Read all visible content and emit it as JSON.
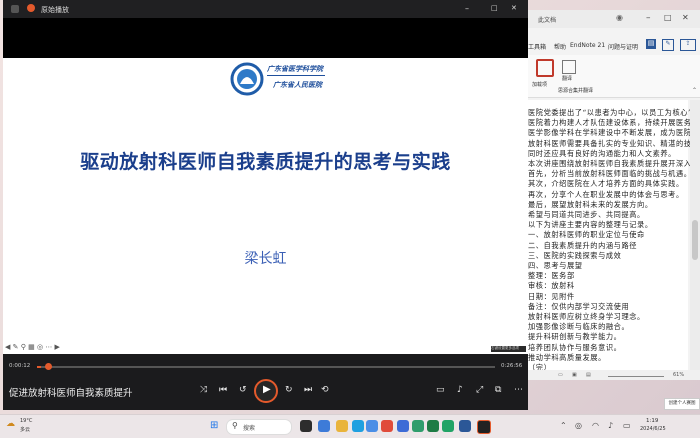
{
  "player": {
    "window_title": "原始播放",
    "slide": {
      "logo_line1": "广东省医学科学院",
      "logo_line2": "广东省人民医院",
      "title": "驱动放射科医师自我素质提升的思考与实践",
      "author": "梁长虹"
    },
    "time_current": "0:00:12",
    "time_total": "0:26:56",
    "progress_fraction": 0.008,
    "now_playing": "促进放射科医师自我素质提升",
    "tooltip": "右键设置更多选项"
  },
  "word": {
    "window_title": "此文档",
    "ribbon_tabs": [
      "工具箱",
      "帮助",
      "EndNote 21",
      "问题与证明"
    ],
    "ribbon_groups": [
      "加载项",
      "翻译",
      "思源合集并翻译"
    ],
    "zoom": "61%",
    "doc_lines": [
      "医院党委提出了“以患者为中心，以员工为核心”的理念。",
      "医院着力构建人才队伍建设体系，持续开展医务人员素质提升工程。",
      "医学影像学科在学科建设中不断发展，成为医院重点学科之一。",
      "放射科医师需要具备扎实的专业知识、精湛的技术水平。",
      "同时还应具有良好的沟通能力和人文素养。",
      "本次讲座围绕放射科医师自我素质提升展开深入探讨。",
      "首先，分析当前放射科医师面临的挑战与机遇。",
      "其次，介绍医院在人才培养方面的具体实践。",
      "再次，分享个人在职业发展中的体会与思考。",
      "最后，展望放射科未来的发展方向。",
      "希望与同道共同进步、共同提高。",
      "以下为讲座主要内容的整理与记录。",
      "一、放射科医师的职业定位与使命",
      "二、自我素质提升的内涵与路径",
      "三、医院的实践探索与成效",
      "四、思考与展望",
      "整理：医务部",
      "审核：放射科",
      "日期：见附件",
      "备注：仅供内部学习交流使用",
      "放射科医师应树立终身学习理念。",
      "加强影像诊断与临床的融合。",
      "提升科研创新与教学能力。",
      "培养团队协作与服务意识。",
      "推动学科高质量发展。",
      "（完）"
    ]
  },
  "taskbar": {
    "weather_temp": "19°C",
    "weather_desc": "多云",
    "search_placeholder": "搜索",
    "clock_time": "1:19",
    "clock_date": "2024/6/25",
    "tooltip_label": "创建个人赛图"
  }
}
